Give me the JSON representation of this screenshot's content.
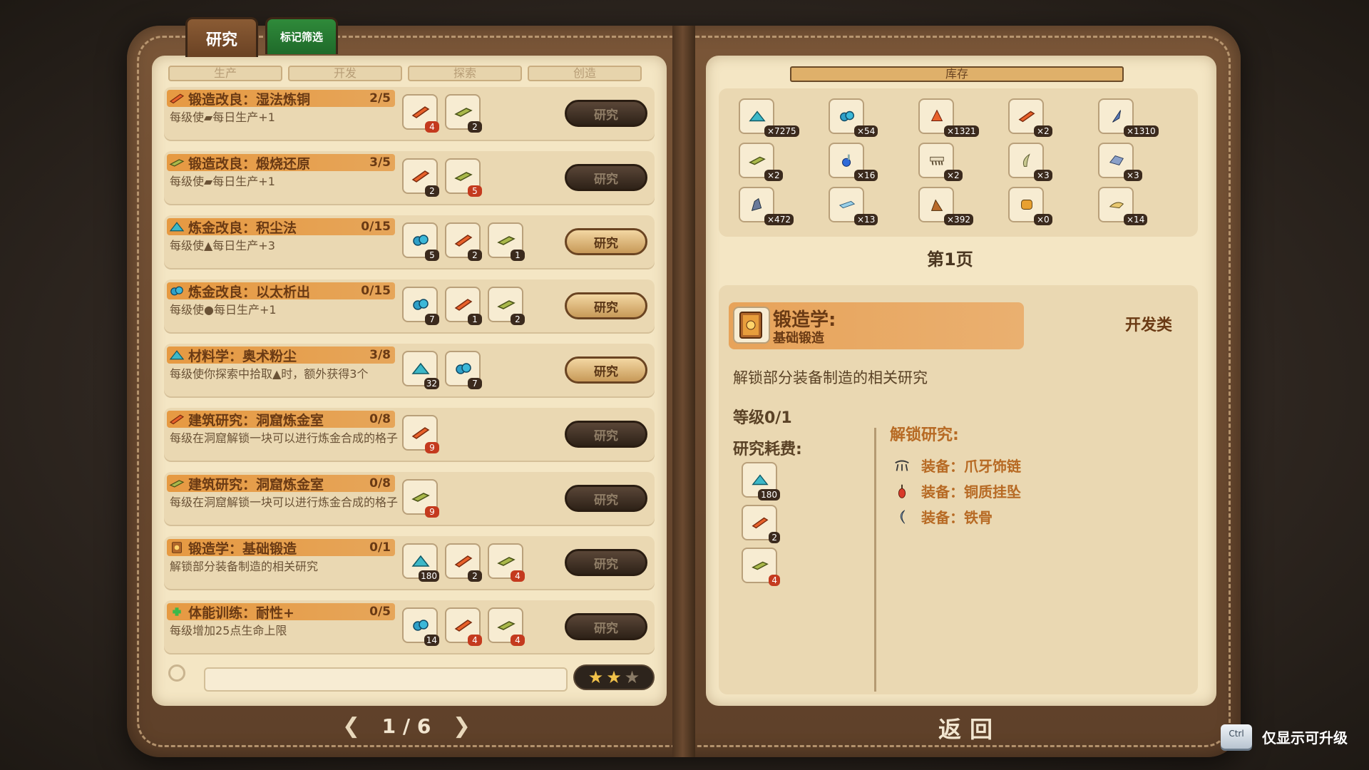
{
  "tabs": {
    "research": "研究",
    "filter": "标记筛选"
  },
  "categories": [
    "生产",
    "开发",
    "探索",
    "创造"
  ],
  "rows": [
    {
      "title": "锻造改良：湿法炼铜",
      "progress": "2/5",
      "desc": "每级使▰每日生产+1",
      "icon": "copper-bar",
      "costs": [
        {
          "icon": "copper-bar",
          "num": "4",
          "red": true
        },
        {
          "icon": "green-bar",
          "num": "2",
          "red": false
        }
      ],
      "btn": "研究",
      "active": false
    },
    {
      "title": "锻造改良：煅烧还原",
      "progress": "3/5",
      "desc": "每级使▰每日生产+1",
      "icon": "green-bar",
      "costs": [
        {
          "icon": "copper-bar",
          "num": "2",
          "red": false
        },
        {
          "icon": "green-bar",
          "num": "5",
          "red": true
        }
      ],
      "btn": "研究",
      "active": false
    },
    {
      "title": "炼金改良：积尘法",
      "progress": "0/15",
      "desc": "每级使▲每日生产+3",
      "icon": "dust",
      "costs": [
        {
          "icon": "ore",
          "num": "5",
          "red": false
        },
        {
          "icon": "copper-bar",
          "num": "2",
          "red": false
        },
        {
          "icon": "green-bar",
          "num": "1",
          "red": false
        }
      ],
      "btn": "研究",
      "active": true
    },
    {
      "title": "炼金改良：以太析出",
      "progress": "0/15",
      "desc": "每级使●每日生产+1",
      "icon": "ore",
      "costs": [
        {
          "icon": "ore",
          "num": "7",
          "red": false
        },
        {
          "icon": "copper-bar",
          "num": "1",
          "red": false
        },
        {
          "icon": "green-bar",
          "num": "2",
          "red": false
        }
      ],
      "btn": "研究",
      "active": true
    },
    {
      "title": "材料学：奥术粉尘",
      "progress": "3/8",
      "desc": "每级使你探索中拾取▲时，额外获得3个",
      "icon": "dust",
      "costs": [
        {
          "icon": "dust",
          "num": "32",
          "red": false
        },
        {
          "icon": "ore",
          "num": "7",
          "red": false
        }
      ],
      "btn": "研究",
      "active": true
    },
    {
      "title": "建筑研究：洞窟炼金室",
      "progress": "0/8",
      "desc": "每级在洞窟解锁一块可以进行炼金合成的格子",
      "icon": "copper-bar",
      "costs": [
        {
          "icon": "copper-bar",
          "num": "9",
          "red": true
        }
      ],
      "btn": "研究",
      "active": false
    },
    {
      "title": "建筑研究：洞窟炼金室",
      "progress": "0/8",
      "desc": "每级在洞窟解锁一块可以进行炼金合成的格子",
      "icon": "green-bar",
      "costs": [
        {
          "icon": "green-bar",
          "num": "9",
          "red": true
        }
      ],
      "btn": "研究",
      "active": false
    },
    {
      "title": "锻造学：基础锻造",
      "progress": "0/1",
      "desc": "解锁部分装备制造的相关研究",
      "icon": "book",
      "costs": [
        {
          "icon": "dust",
          "num": "180",
          "red": false
        },
        {
          "icon": "copper-bar",
          "num": "2",
          "red": false
        },
        {
          "icon": "green-bar",
          "num": "4",
          "red": true
        }
      ],
      "btn": "研究",
      "active": false
    },
    {
      "title": "体能训练：耐性+",
      "progress": "0/5",
      "desc": "每级增加25点生命上限",
      "icon": "plus",
      "costs": [
        {
          "icon": "ore",
          "num": "14",
          "red": false
        },
        {
          "icon": "copper-bar",
          "num": "4",
          "red": true
        },
        {
          "icon": "green-bar",
          "num": "4",
          "red": true
        }
      ],
      "btn": "研究",
      "active": false
    }
  ],
  "stars": {
    "filled": 2,
    "total": 3
  },
  "pager": {
    "text": "1 / 6"
  },
  "inventory": {
    "header": "库存",
    "items": [
      {
        "icon": "dust",
        "num": "×7275"
      },
      {
        "icon": "ore",
        "num": "×54"
      },
      {
        "icon": "fire-crystal",
        "num": "×1321"
      },
      {
        "icon": "copper-bar",
        "num": "×2"
      },
      {
        "icon": "feather",
        "num": "×1310"
      },
      {
        "icon": "green-bar",
        "num": "×2"
      },
      {
        "icon": "potion",
        "num": "×16"
      },
      {
        "icon": "claw",
        "num": "×2"
      },
      {
        "icon": "horn",
        "num": "×3"
      },
      {
        "icon": "stone",
        "num": "×3"
      },
      {
        "icon": "crystal",
        "num": "×472"
      },
      {
        "icon": "ice-bar",
        "num": "×13"
      },
      {
        "icon": "rock",
        "num": "×392"
      },
      {
        "icon": "amber",
        "num": "×0"
      },
      {
        "icon": "fang",
        "num": "×14"
      }
    ],
    "page_label": "第1页"
  },
  "detail": {
    "name": "锻造学:",
    "sub": "基础锻造",
    "type": "开发类",
    "desc": "解锁部分装备制造的相关研究",
    "level": "等级0/1",
    "cost_label": "研究耗费:",
    "costs": [
      {
        "icon": "dust",
        "num": "180",
        "red": false
      },
      {
        "icon": "copper-bar",
        "num": "2",
        "red": false
      },
      {
        "icon": "green-bar",
        "num": "4",
        "red": true
      }
    ],
    "unlock_label": "解锁研究:",
    "unlocks": [
      {
        "icon": "claw-necklace",
        "text": "装备：爪牙饰链"
      },
      {
        "icon": "copper-pendant",
        "text": "装备：铜质挂坠"
      },
      {
        "icon": "iron-bone",
        "text": "装备：铁骨"
      }
    ]
  },
  "back": "返回",
  "hint": {
    "key": "Ctrl",
    "text": "仅显示可升级"
  },
  "colors": {
    "accent_orange": "#e6963c",
    "text_brown": "#6a3a14",
    "page": "#f4e6c4",
    "leather": "#6b4a30"
  }
}
